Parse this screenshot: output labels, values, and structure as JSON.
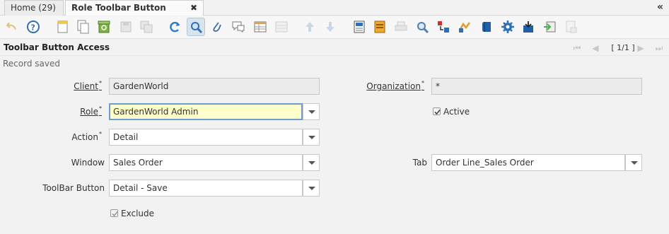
{
  "tabs": [
    {
      "label": "Home (29)"
    },
    {
      "label": "Role Toolbar Button Access"
    }
  ],
  "icons": [
    "undo-icon",
    "help-icon",
    "new-record-icon",
    "copy-record-icon",
    "delete-icon",
    "save-icon",
    "save-new-icon",
    "refresh-icon",
    "find-icon",
    "attachment-icon",
    "chat-icon",
    "grid-toggle-icon",
    "multi-record-icon",
    "parent-record-icon",
    "detail-record-icon",
    "history-icon",
    "archive-icon",
    "print-icon",
    "zoom-across-icon",
    "requests-icon",
    "workflow-icon",
    "product-info-icon",
    "process-icon",
    "export-icon",
    "import-icon",
    "post-icon"
  ],
  "header": {
    "title": "Toolbar Button Access",
    "record_counter": "[ 1/1 ]"
  },
  "status": "Record saved",
  "form": {
    "client": {
      "label": "Client",
      "value": "GardenWorld",
      "required": true
    },
    "organization": {
      "label": "Organization",
      "value": "*",
      "required": true
    },
    "role": {
      "label": "Role",
      "value": "GardenWorld Admin",
      "required": true
    },
    "active": {
      "label": "Active",
      "checked": true
    },
    "action": {
      "label": "Action",
      "value": "Detail",
      "required": true
    },
    "window": {
      "label": "Window",
      "value": "Sales Order"
    },
    "tab": {
      "label": "Tab",
      "value": "Order Line_Sales Order"
    },
    "toolbar_button": {
      "label": "ToolBar Button",
      "value": "Detail - Save"
    },
    "exclude": {
      "label": "Exclude",
      "checked": true
    }
  },
  "colors": {
    "focus_field_bg": "#ffffcc",
    "readonly_field_bg": "#ececec",
    "selected_tool_bg": "#d8e3ee"
  }
}
